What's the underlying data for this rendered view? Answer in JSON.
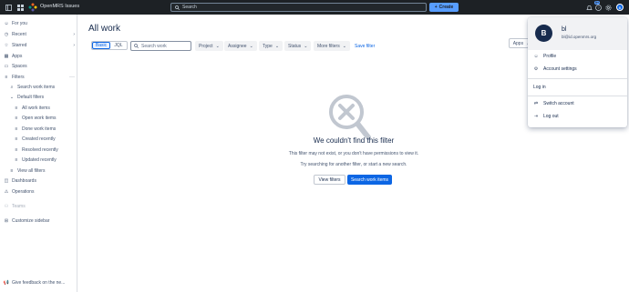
{
  "topbar": {
    "app_title": "OpenMRS Issues",
    "search_placeholder": "Search",
    "create_label": "Create",
    "notifications_badge": "9+",
    "avatar_initial": "B"
  },
  "sidebar": {
    "items": [
      {
        "label": "For you",
        "icon": "person-icon"
      },
      {
        "label": "Recent",
        "icon": "clock-icon"
      },
      {
        "label": "Starred",
        "icon": "star-icon"
      },
      {
        "label": "Apps",
        "icon": "apps-icon"
      },
      {
        "label": "Spaces",
        "icon": "spaces-icon"
      },
      {
        "label": "Filters",
        "icon": "filter-icon"
      },
      {
        "label": "Search work items",
        "icon": "search-icon"
      },
      {
        "label": "Default filters",
        "icon": "chevron-down-icon"
      },
      {
        "label": "All work items",
        "icon": "filter-lines-icon"
      },
      {
        "label": "Open work items",
        "icon": "filter-lines-icon"
      },
      {
        "label": "Done work items",
        "icon": "filter-lines-icon"
      },
      {
        "label": "Created recently",
        "icon": "filter-lines-icon"
      },
      {
        "label": "Resolved recently",
        "icon": "filter-lines-icon"
      },
      {
        "label": "Updated recently",
        "icon": "filter-lines-icon"
      },
      {
        "label": "View all filters",
        "icon": "filter-lines-icon"
      },
      {
        "label": "Dashboards",
        "icon": "dashboard-icon"
      },
      {
        "label": "Operations",
        "icon": "operations-icon"
      },
      {
        "label": "Teams",
        "icon": "teams-icon"
      },
      {
        "label": "Customize sidebar",
        "icon": "customize-icon"
      },
      {
        "label": "Give feedback on the ne...",
        "icon": "megaphone-icon"
      }
    ]
  },
  "main": {
    "title": "All work",
    "toggle": {
      "basic": "Basic",
      "jql": "JQL"
    },
    "search_placeholder": "Search work",
    "filters": [
      "Project",
      "Assignee",
      "Type",
      "Status",
      "More filters"
    ],
    "save_filter": "Save filter",
    "apps_label": "Apps",
    "empty": {
      "title": "We couldn't find this filter",
      "desc1": "This filter may not exist, or you don't have permissions to view it.",
      "desc2": "Try searching for another filter, or start a new search.",
      "view_filters": "View filters",
      "search_work_items": "Search work items"
    }
  },
  "account_menu": {
    "initial": "B",
    "name": "bl",
    "email": "bl@id.openmrs.org",
    "items": [
      {
        "label": "Profile",
        "icon": "profile-icon"
      },
      {
        "label": "Account settings",
        "icon": "settings-icon"
      },
      {
        "label": "Log in",
        "icon": ""
      },
      {
        "label": "Switch account",
        "icon": "switch-account-icon"
      },
      {
        "label": "Log out",
        "icon": "logout-icon"
      }
    ]
  },
  "colors": {
    "accent": "#0c66e4",
    "topbar": "#1d2125"
  }
}
